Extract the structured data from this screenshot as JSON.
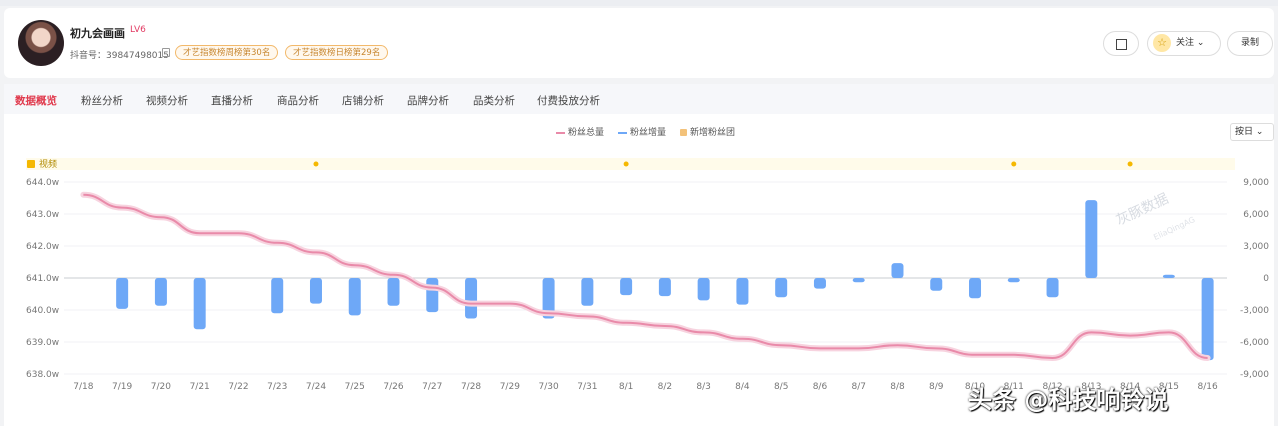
{
  "profile": {
    "name": "初九会画画",
    "level": "LV6",
    "douyin_id": "抖音号：39847498015",
    "badges": [
      "才艺指数榜周榜第30名",
      "才艺指数榜日榜第29名"
    ],
    "follow_label": "关注",
    "record_label": "录制"
  },
  "tabs": [
    "数据概览",
    "粉丝分析",
    "视频分析",
    "直播分析",
    "商品分析",
    "店铺分析",
    "品牌分析",
    "品类分析",
    "付费投放分析"
  ],
  "active_tab": 0,
  "legend": [
    "粉丝总量",
    "粉丝增量",
    "新增粉丝团"
  ],
  "select_value": "按日",
  "video_row_label": "视频",
  "watermark": "灰豚数据",
  "watermark_sub": "EliaQingAG",
  "overlay": "头条 @科技响铃说",
  "colors": {
    "bar": "#6ea8f7",
    "line": "#e98aa9",
    "accent": "#e03a4d",
    "video": "#f5b800"
  },
  "chart_data": {
    "type": "bar+line",
    "categories": [
      "7/18",
      "7/19",
      "7/20",
      "7/21",
      "7/22",
      "7/23",
      "7/24",
      "7/25",
      "7/26",
      "7/27",
      "7/28",
      "7/29",
      "7/30",
      "7/31",
      "8/1",
      "8/2",
      "8/3",
      "8/4",
      "8/5",
      "8/6",
      "8/7",
      "8/8",
      "8/9",
      "8/10",
      "8/11",
      "8/12",
      "8/13",
      "8/14",
      "8/15",
      "8/16"
    ],
    "y_left_ticks": [
      "644.0w",
      "643.0w",
      "642.0w",
      "641.0w",
      "640.0w",
      "639.0w",
      "638.0w"
    ],
    "y_right_ticks": [
      "9,000",
      "6,000",
      "3,000",
      "0",
      "-3,000",
      "-6,000",
      "-9,000"
    ],
    "y_left_range": [
      638.0,
      644.0
    ],
    "y_right_range": [
      -9000,
      9000
    ],
    "series": [
      {
        "name": "粉丝总量",
        "axis": "left",
        "values": [
          643.6,
          643.2,
          642.9,
          642.4,
          642.4,
          642.1,
          641.8,
          641.4,
          641.1,
          640.7,
          640.2,
          640.2,
          639.9,
          639.8,
          639.6,
          639.5,
          639.3,
          639.1,
          638.9,
          638.8,
          638.8,
          638.9,
          638.8,
          638.6,
          638.6,
          638.5,
          639.3,
          639.2,
          639.3,
          638.5
        ]
      },
      {
        "name": "粉丝增量",
        "axis": "right",
        "values": [
          null,
          -2900,
          -2600,
          -4800,
          null,
          -3300,
          -2400,
          -3500,
          -2600,
          -3200,
          -3800,
          null,
          -3800,
          -2600,
          -1600,
          -1700,
          -2100,
          -2500,
          -1800,
          -1000,
          -400,
          1400,
          -1200,
          -1900,
          -400,
          -1800,
          7300,
          null,
          300,
          -7700
        ]
      }
    ],
    "video_markers": [
      "7/24",
      "8/1",
      "8/11",
      "8/14"
    ],
    "grid": true,
    "legend_position": "top-center"
  }
}
